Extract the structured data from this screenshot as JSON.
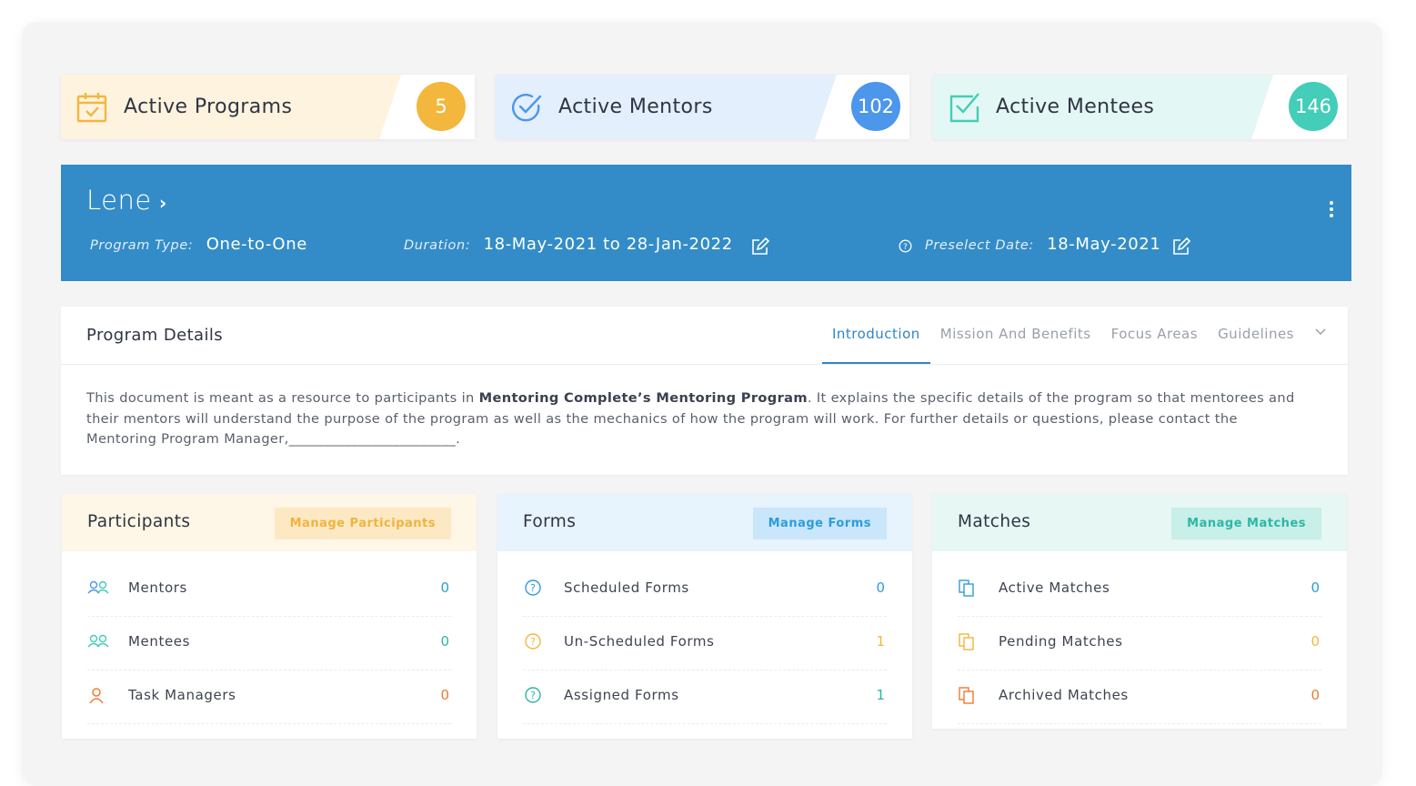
{
  "stats": [
    {
      "label": "Active Programs",
      "count": "5",
      "icon": "calendar-check-icon",
      "tint": "#fef3de",
      "accent": "#f3b73d"
    },
    {
      "label": "Active Mentors",
      "count": "102",
      "icon": "check-circle-icon",
      "tint": "#e3effc",
      "accent": "#4c96ec"
    },
    {
      "label": "Active Mentees",
      "count": "146",
      "icon": "checkbox-icon",
      "tint": "#e3f7f4",
      "accent": "#44cdb8"
    }
  ],
  "program": {
    "name": "Lene",
    "type_label": "Program Type:",
    "type_value": "One-to-One",
    "duration_label": "Duration:",
    "duration_value": "18-May-2021 to 28-Jan-2022",
    "preselect_label": "Preselect Date:",
    "preselect_value": "18-May-2021",
    "banner_color": "#338cc8"
  },
  "details": {
    "title": "Program Details",
    "tabs": [
      "Introduction",
      "Mission And Benefits",
      "Focus Areas",
      "Guidelines"
    ],
    "active_tab": "Introduction",
    "text_before": "This document is meant as a resource to participants in ",
    "text_bold": "Mentoring Complete’s Mentoring Program",
    "text_after": ".  It explains the specific details of the program so that mentorees and their mentors will understand the purpose of the program as well as the mechanics of how the program will work.  For further details or questions, please contact the Mentoring Program Manager,________________________."
  },
  "panels": {
    "participants": {
      "title": "Participants",
      "button": "Manage Participants",
      "rows": [
        {
          "label": "Mentors",
          "value": "0",
          "icon": "users-icon"
        },
        {
          "label": "Mentees",
          "value": "0",
          "icon": "users-icon"
        },
        {
          "label": "Task Managers",
          "value": "0",
          "icon": "user-icon"
        }
      ]
    },
    "forms": {
      "title": "Forms",
      "button": "Manage Forms",
      "rows": [
        {
          "label": "Scheduled Forms",
          "value": "0",
          "icon": "help-circle-icon"
        },
        {
          "label": "Un-Scheduled Forms",
          "value": "1",
          "icon": "help-circle-icon"
        },
        {
          "label": "Assigned Forms",
          "value": "1",
          "icon": "help-circle-icon"
        }
      ]
    },
    "matches": {
      "title": "Matches",
      "button": "Manage Matches",
      "rows": [
        {
          "label": "Active Matches",
          "value": "0",
          "icon": "copy-icon"
        },
        {
          "label": "Pending Matches",
          "value": "0",
          "icon": "copy-icon"
        },
        {
          "label": "Archived Matches",
          "value": "0",
          "icon": "copy-icon"
        }
      ]
    }
  }
}
